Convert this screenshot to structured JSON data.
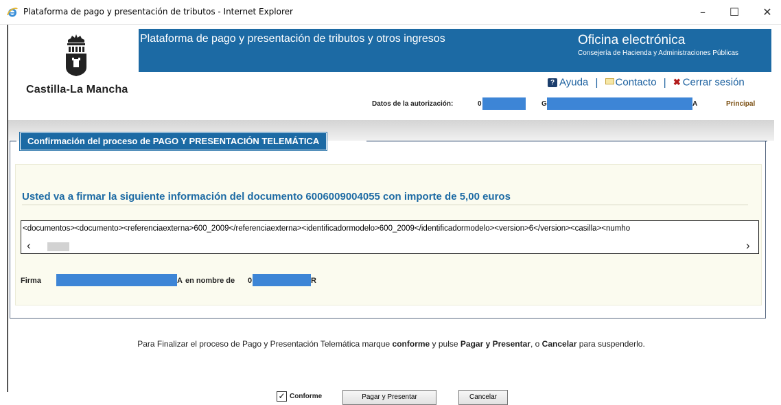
{
  "window": {
    "title": "Plataforma de pago y presentación de tributos - Internet Explorer",
    "minimize": "–",
    "maximize": "☐",
    "close": "✕"
  },
  "header": {
    "logo_text": "Castilla-La Mancha",
    "banner_title": "Plataforma de pago y presentación de tributos y otros ingresos",
    "office_title": "Oficina electrónica",
    "office_subtitle": "Consejería de Hacienda y Administraciones Públicas",
    "links": {
      "help": "Ayuda",
      "separator": "|",
      "contact": "Contacto",
      "logout": "Cerrar sesión"
    },
    "auth": {
      "label": "Datos de la autorización:",
      "value_start": "0",
      "name_start": "G",
      "name_end": "A",
      "role": "Principal"
    }
  },
  "confirmation": {
    "legend": "Confirmación del proceso de PAGO Y PRESENTACIÓN TELEMÁTICA",
    "heading": "Usted va a firmar la siguiente información del documento 6006009004055 con importe de 5,00 euros",
    "xml_content": "<documentos><documento><referenciaexterna>600_2009</referenciaexterna><identificadormodelo>600_2009</identificadormodelo><version>6</version><casilla><numho",
    "firma": {
      "label": "Firma",
      "name_end": "A",
      "middle": "en nombre de",
      "nif_start": "0",
      "nif_end": "R"
    }
  },
  "footer": {
    "instructions": {
      "part1": "Para Finalizar el proceso de Pago y Presentación Telemática marque ",
      "conforme": "conforme",
      "part2": " y pulse ",
      "pagar": "Pagar y Presentar",
      "part3": ", o ",
      "cancelar": "Cancelar",
      "part4": " para suspenderlo."
    },
    "checkbox_label": "Conforme",
    "checkbox_checked": true,
    "pagar_button": "Pagar y Presentar",
    "cancel_button": "Cancelar"
  },
  "colors": {
    "brand_blue": "#1c6aa4",
    "redaction": "#3d85d6",
    "panel_bg": "#fbfbef"
  }
}
